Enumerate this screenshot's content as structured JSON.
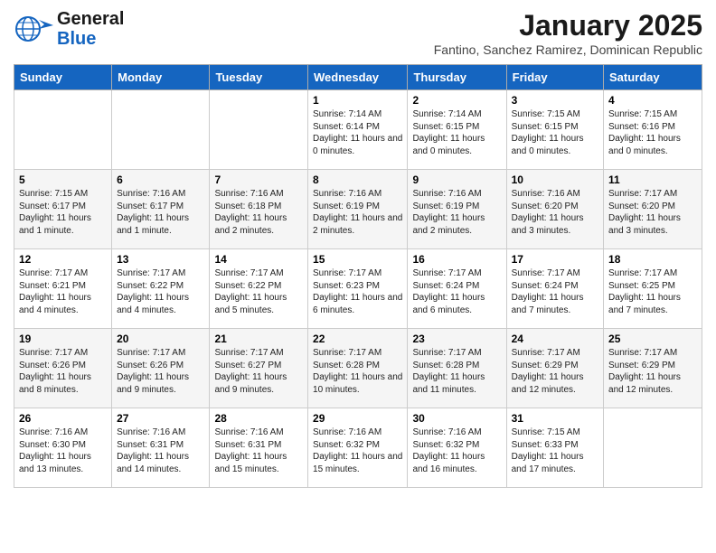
{
  "logo": {
    "line1": "General",
    "line2": "Blue"
  },
  "title": "January 2025",
  "subtitle": "Fantino, Sanchez Ramirez, Dominican Republic",
  "days_of_week": [
    "Sunday",
    "Monday",
    "Tuesday",
    "Wednesday",
    "Thursday",
    "Friday",
    "Saturday"
  ],
  "weeks": [
    [
      {
        "day": "",
        "info": ""
      },
      {
        "day": "",
        "info": ""
      },
      {
        "day": "",
        "info": ""
      },
      {
        "day": "1",
        "info": "Sunrise: 7:14 AM\nSunset: 6:14 PM\nDaylight: 11 hours and 0 minutes."
      },
      {
        "day": "2",
        "info": "Sunrise: 7:14 AM\nSunset: 6:15 PM\nDaylight: 11 hours and 0 minutes."
      },
      {
        "day": "3",
        "info": "Sunrise: 7:15 AM\nSunset: 6:15 PM\nDaylight: 11 hours and 0 minutes."
      },
      {
        "day": "4",
        "info": "Sunrise: 7:15 AM\nSunset: 6:16 PM\nDaylight: 11 hours and 0 minutes."
      }
    ],
    [
      {
        "day": "5",
        "info": "Sunrise: 7:15 AM\nSunset: 6:17 PM\nDaylight: 11 hours and 1 minute."
      },
      {
        "day": "6",
        "info": "Sunrise: 7:16 AM\nSunset: 6:17 PM\nDaylight: 11 hours and 1 minute."
      },
      {
        "day": "7",
        "info": "Sunrise: 7:16 AM\nSunset: 6:18 PM\nDaylight: 11 hours and 2 minutes."
      },
      {
        "day": "8",
        "info": "Sunrise: 7:16 AM\nSunset: 6:19 PM\nDaylight: 11 hours and 2 minutes."
      },
      {
        "day": "9",
        "info": "Sunrise: 7:16 AM\nSunset: 6:19 PM\nDaylight: 11 hours and 2 minutes."
      },
      {
        "day": "10",
        "info": "Sunrise: 7:16 AM\nSunset: 6:20 PM\nDaylight: 11 hours and 3 minutes."
      },
      {
        "day": "11",
        "info": "Sunrise: 7:17 AM\nSunset: 6:20 PM\nDaylight: 11 hours and 3 minutes."
      }
    ],
    [
      {
        "day": "12",
        "info": "Sunrise: 7:17 AM\nSunset: 6:21 PM\nDaylight: 11 hours and 4 minutes."
      },
      {
        "day": "13",
        "info": "Sunrise: 7:17 AM\nSunset: 6:22 PM\nDaylight: 11 hours and 4 minutes."
      },
      {
        "day": "14",
        "info": "Sunrise: 7:17 AM\nSunset: 6:22 PM\nDaylight: 11 hours and 5 minutes."
      },
      {
        "day": "15",
        "info": "Sunrise: 7:17 AM\nSunset: 6:23 PM\nDaylight: 11 hours and 6 minutes."
      },
      {
        "day": "16",
        "info": "Sunrise: 7:17 AM\nSunset: 6:24 PM\nDaylight: 11 hours and 6 minutes."
      },
      {
        "day": "17",
        "info": "Sunrise: 7:17 AM\nSunset: 6:24 PM\nDaylight: 11 hours and 7 minutes."
      },
      {
        "day": "18",
        "info": "Sunrise: 7:17 AM\nSunset: 6:25 PM\nDaylight: 11 hours and 7 minutes."
      }
    ],
    [
      {
        "day": "19",
        "info": "Sunrise: 7:17 AM\nSunset: 6:26 PM\nDaylight: 11 hours and 8 minutes."
      },
      {
        "day": "20",
        "info": "Sunrise: 7:17 AM\nSunset: 6:26 PM\nDaylight: 11 hours and 9 minutes."
      },
      {
        "day": "21",
        "info": "Sunrise: 7:17 AM\nSunset: 6:27 PM\nDaylight: 11 hours and 9 minutes."
      },
      {
        "day": "22",
        "info": "Sunrise: 7:17 AM\nSunset: 6:28 PM\nDaylight: 11 hours and 10 minutes."
      },
      {
        "day": "23",
        "info": "Sunrise: 7:17 AM\nSunset: 6:28 PM\nDaylight: 11 hours and 11 minutes."
      },
      {
        "day": "24",
        "info": "Sunrise: 7:17 AM\nSunset: 6:29 PM\nDaylight: 11 hours and 12 minutes."
      },
      {
        "day": "25",
        "info": "Sunrise: 7:17 AM\nSunset: 6:29 PM\nDaylight: 11 hours and 12 minutes."
      }
    ],
    [
      {
        "day": "26",
        "info": "Sunrise: 7:16 AM\nSunset: 6:30 PM\nDaylight: 11 hours and 13 minutes."
      },
      {
        "day": "27",
        "info": "Sunrise: 7:16 AM\nSunset: 6:31 PM\nDaylight: 11 hours and 14 minutes."
      },
      {
        "day": "28",
        "info": "Sunrise: 7:16 AM\nSunset: 6:31 PM\nDaylight: 11 hours and 15 minutes."
      },
      {
        "day": "29",
        "info": "Sunrise: 7:16 AM\nSunset: 6:32 PM\nDaylight: 11 hours and 15 minutes."
      },
      {
        "day": "30",
        "info": "Sunrise: 7:16 AM\nSunset: 6:32 PM\nDaylight: 11 hours and 16 minutes."
      },
      {
        "day": "31",
        "info": "Sunrise: 7:15 AM\nSunset: 6:33 PM\nDaylight: 11 hours and 17 minutes."
      },
      {
        "day": "",
        "info": ""
      }
    ]
  ]
}
